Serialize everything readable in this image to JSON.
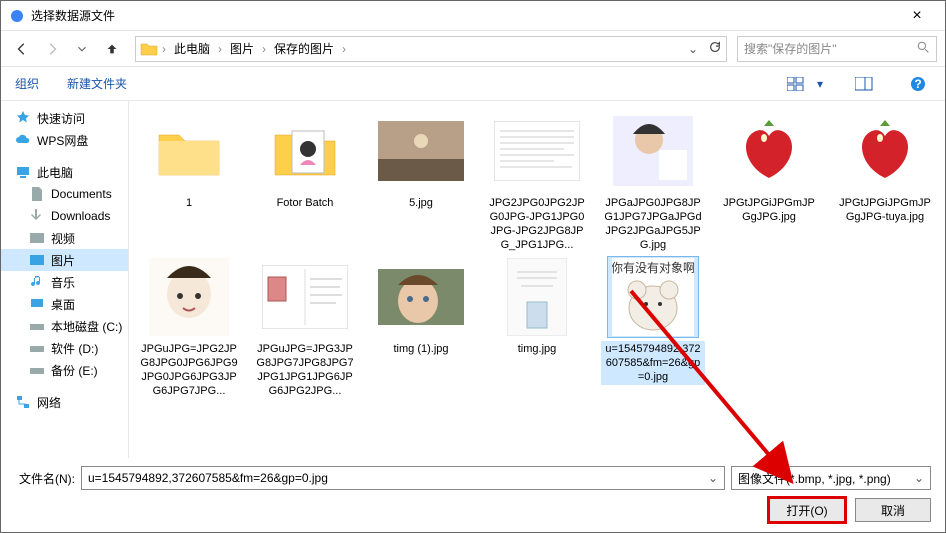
{
  "window": {
    "title": "选择数据源文件"
  },
  "breadcrumbs": {
    "root": "此电脑",
    "b1": "图片",
    "b2": "保存的图片"
  },
  "search": {
    "placeholder": "搜索\"保存的图片\""
  },
  "toolbar": {
    "organize": "组织",
    "newfolder": "新建文件夹"
  },
  "sidebar": {
    "quick": "快速访问",
    "wps": "WPS网盘",
    "pc": "此电脑",
    "docs": "Documents",
    "downloads": "Downloads",
    "videos": "视频",
    "pictures": "图片",
    "music": "音乐",
    "desktop": "桌面",
    "localdisk": "本地磁盘 (C:)",
    "soft": "软件 (D:)",
    "backup": "备份 (E:)",
    "network": "网络"
  },
  "files": {
    "f0": "1",
    "f1": "Fotor Batch",
    "f2": "5.jpg",
    "f3": "JPG2JPG0JPG2JPG0JPG-JPG1JPG0JPG-JPG2JPG8JPG_JPG1JPG...",
    "f4": "JPGaJPG0JPG8JPG1JPG7JPGaJPGdJPG2JPGaJPG5JPG.jpg",
    "f5": "JPGtJPGiJPGmJPGgJPG.jpg",
    "f6": "JPGtJPGiJPGmJPGgJPG-tuya.jpg",
    "f7": "JPGuJPG=JPG2JPG8JPG0JPG6JPG9JPG0JPG6JPG3JPG6JPG7JPG...",
    "f8": "JPGuJPG=JPG3JPG8JPG7JPG8JPG7JPG1JPG1JPG6JPG6JPG2JPG...",
    "f9": "timg (1).jpg",
    "f10": "timg.jpg",
    "f11": "u=1545794892,372607585&fm=26&gp=0.jpg",
    "thumb11_text": "你有没有对象啊"
  },
  "bottom": {
    "filename_label": "文件名(N):",
    "filename_value": "u=1545794892,372607585&fm=26&gp=0.jpg",
    "filter": "图像文件(*.bmp, *.jpg, *.png)",
    "open": "打开(O)",
    "cancel": "取消"
  }
}
